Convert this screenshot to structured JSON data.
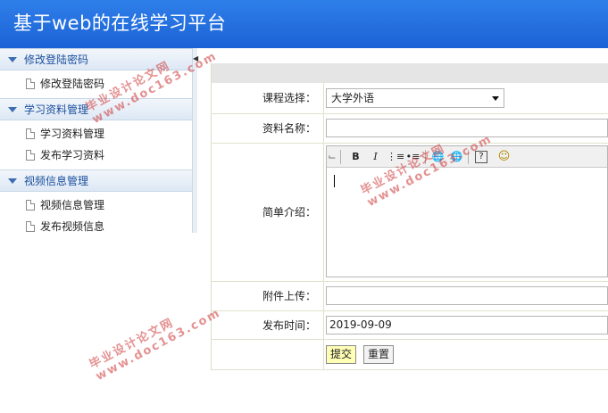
{
  "app": {
    "title": "基于web的在线学习平台"
  },
  "sidebar": {
    "groups": [
      {
        "label": "修改登陆密码",
        "items": [
          "修改登陆密码"
        ]
      },
      {
        "label": "学习资料管理",
        "items": [
          "学习资料管理",
          "发布学习资料"
        ]
      },
      {
        "label": "视频信息管理",
        "items": [
          "视频信息管理",
          "发布视频信息"
        ]
      }
    ]
  },
  "form": {
    "course": {
      "label": "课程选择：",
      "value": "大学外语"
    },
    "name": {
      "label": "资料名称：",
      "value": ""
    },
    "intro": {
      "label": "简单介绍："
    },
    "attachment": {
      "label": "附件上传：",
      "value": ""
    },
    "publish_time": {
      "label": "发布时间：",
      "value": "2019-09-09"
    },
    "submit_label": "提交",
    "reset_label": "重置"
  },
  "editor": {
    "toolbar": [
      "text-mode-icon",
      "bold-icon",
      "italic-icon",
      "ordered-list-icon",
      "unordered-list-icon",
      "link-icon",
      "unlink-icon",
      "help-icon",
      "smiley-icon"
    ],
    "bold_glyph": "B",
    "italic_glyph": "I"
  },
  "watermark": {
    "line1": "毕业设计论文网",
    "line2": "www.doc163.com"
  }
}
